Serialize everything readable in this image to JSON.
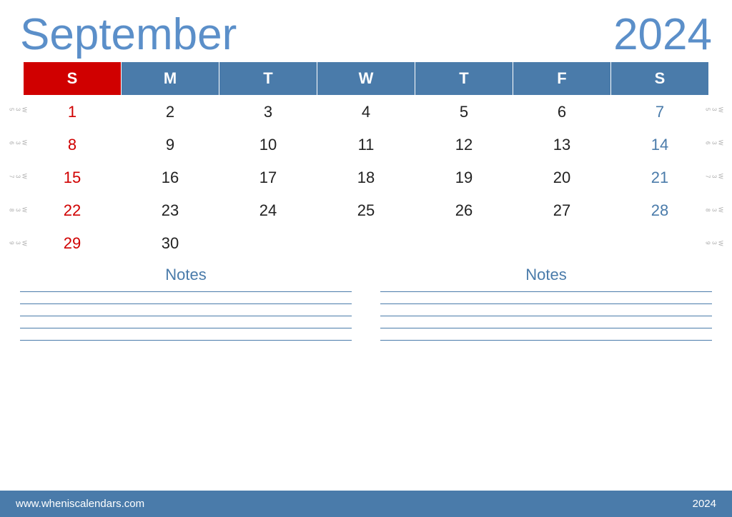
{
  "header": {
    "month": "September",
    "year": "2024"
  },
  "calendar": {
    "days_header": [
      "S",
      "M",
      "T",
      "W",
      "T",
      "F",
      "S"
    ],
    "weeks": [
      {
        "week_num": "W35",
        "days": [
          {
            "num": "1",
            "type": "sunday"
          },
          {
            "num": "2",
            "type": "normal"
          },
          {
            "num": "3",
            "type": "normal"
          },
          {
            "num": "4",
            "type": "normal"
          },
          {
            "num": "5",
            "type": "normal"
          },
          {
            "num": "6",
            "type": "normal"
          },
          {
            "num": "7",
            "type": "saturday"
          }
        ]
      },
      {
        "week_num": "W36",
        "days": [
          {
            "num": "8",
            "type": "sunday"
          },
          {
            "num": "9",
            "type": "normal"
          },
          {
            "num": "10",
            "type": "normal"
          },
          {
            "num": "11",
            "type": "normal"
          },
          {
            "num": "12",
            "type": "normal"
          },
          {
            "num": "13",
            "type": "normal"
          },
          {
            "num": "14",
            "type": "saturday"
          }
        ]
      },
      {
        "week_num": "W37",
        "days": [
          {
            "num": "15",
            "type": "sunday"
          },
          {
            "num": "16",
            "type": "normal"
          },
          {
            "num": "17",
            "type": "normal"
          },
          {
            "num": "18",
            "type": "normal"
          },
          {
            "num": "19",
            "type": "normal"
          },
          {
            "num": "20",
            "type": "normal"
          },
          {
            "num": "21",
            "type": "saturday"
          }
        ]
      },
      {
        "week_num": "W38",
        "days": [
          {
            "num": "22",
            "type": "sunday"
          },
          {
            "num": "23",
            "type": "normal"
          },
          {
            "num": "24",
            "type": "normal"
          },
          {
            "num": "25",
            "type": "normal"
          },
          {
            "num": "26",
            "type": "normal"
          },
          {
            "num": "27",
            "type": "normal"
          },
          {
            "num": "28",
            "type": "saturday"
          }
        ]
      },
      {
        "week_num": "W39",
        "days": [
          {
            "num": "29",
            "type": "sunday"
          },
          {
            "num": "30",
            "type": "normal"
          },
          {
            "num": "",
            "type": "empty"
          },
          {
            "num": "",
            "type": "empty"
          },
          {
            "num": "",
            "type": "empty"
          },
          {
            "num": "",
            "type": "empty"
          },
          {
            "num": "",
            "type": "empty"
          }
        ]
      }
    ]
  },
  "notes": {
    "left_label": "Notes",
    "right_label": "Notes",
    "line_count": 5
  },
  "footer": {
    "url": "www.wheniscalendars.com",
    "year": "2024"
  },
  "colors": {
    "blue": "#4a7baa",
    "red": "#d00000",
    "saturday_blue": "#4a7baa",
    "header_bg": "#4a7baa",
    "sunday_bg": "#d00000"
  }
}
